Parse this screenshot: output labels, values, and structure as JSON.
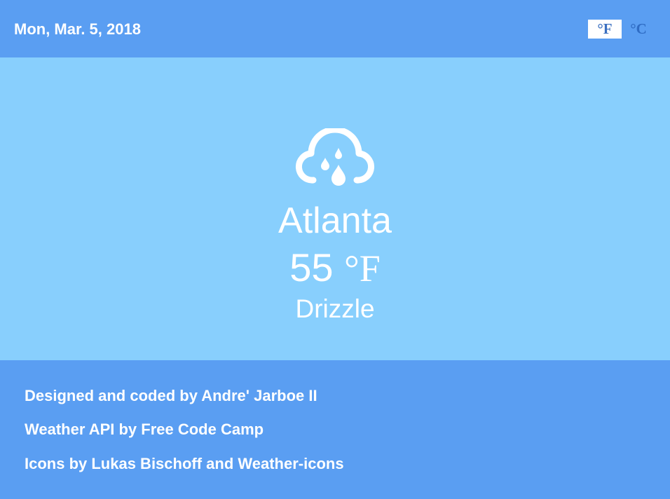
{
  "header": {
    "date": "Mon, Mar. 5, 2018",
    "unit_fahrenheit": "°F",
    "unit_celsius": "°C",
    "selected_unit": "°F"
  },
  "weather": {
    "icon": "cloud-drizzle-icon",
    "city": "Atlanta",
    "temperature": "55",
    "temperature_unit": "°F",
    "condition": "Drizzle"
  },
  "footer": {
    "credits": [
      "Designed and coded by Andre' Jarboe II",
      "Weather API by Free Code Camp",
      "Icons by Lukas Bischoff and Weather-icons"
    ]
  },
  "colors": {
    "header_bg": "#5a9ef2",
    "main_bg": "#88cffd",
    "footer_bg": "#5a9ef2",
    "text": "#ffffff",
    "unit_active_text": "#3a6fc0"
  }
}
